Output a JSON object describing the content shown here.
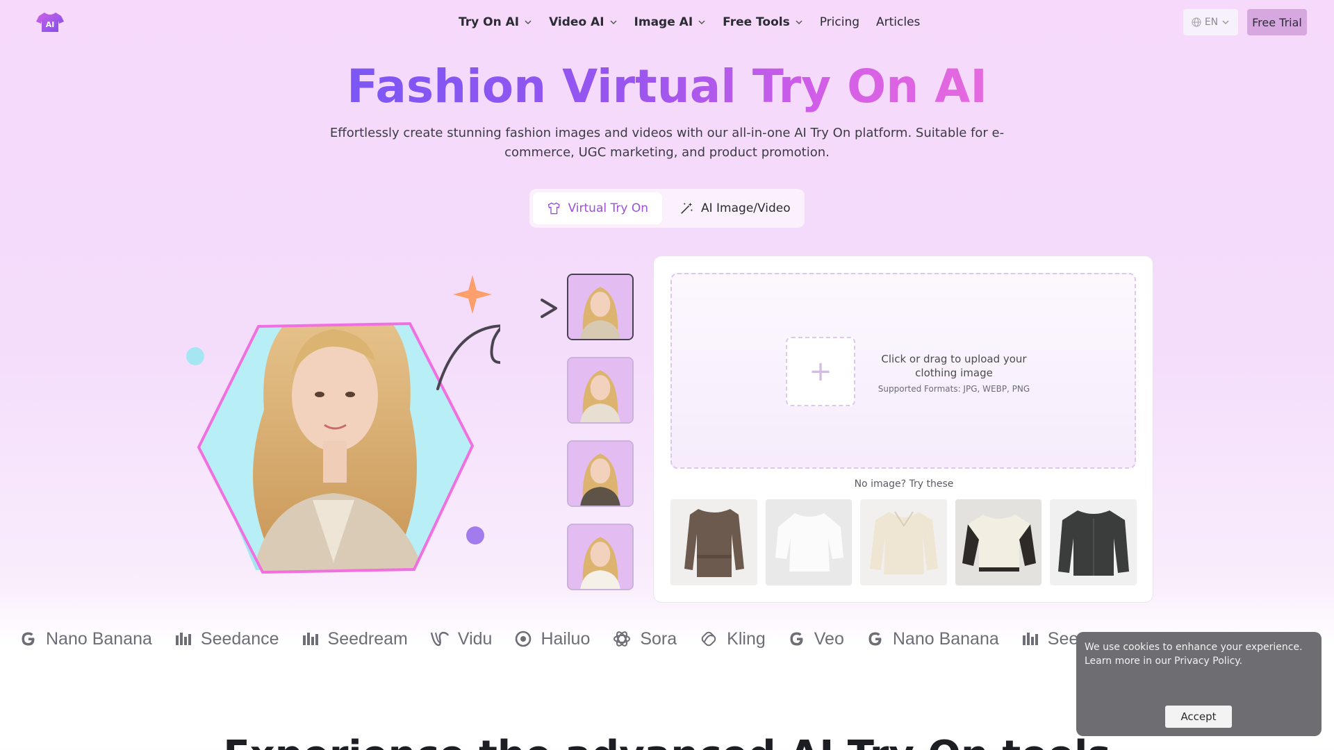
{
  "nav": {
    "logo_text": "AI",
    "links": [
      {
        "label": "Try On AI",
        "dropdown": true
      },
      {
        "label": "Video AI",
        "dropdown": true
      },
      {
        "label": "Image AI",
        "dropdown": true
      },
      {
        "label": "Free Tools",
        "dropdown": true
      },
      {
        "label": "Pricing",
        "dropdown": false
      },
      {
        "label": "Articles",
        "dropdown": false
      }
    ],
    "language": "EN",
    "cta": "Free Trial"
  },
  "hero": {
    "title": "Fashion Virtual Try On AI",
    "subtitle": "Effortlessly create stunning fashion images and videos with our all-in-one AI Try On platform. Suitable for e-commerce, UGC marketing, and product promotion."
  },
  "tabs": [
    {
      "label": "Virtual Try On",
      "active": true,
      "icon": "tshirt-icon"
    },
    {
      "label": "AI Image/Video",
      "active": false,
      "icon": "magic-wand-icon"
    }
  ],
  "upload": {
    "prompt": "Click or drag to upload your clothing image",
    "formats": "Supported Formats: JPG, WEBP, PNG",
    "try_these": "No image? Try these",
    "samples": [
      "brown-shirt-jacket",
      "white-blouse",
      "cream-sweater",
      "varsity-jacket",
      "black-leather-jacket"
    ]
  },
  "models": [
    {
      "name": "Nano Banana",
      "icon": "google-icon"
    },
    {
      "name": "Seedance",
      "icon": "bars-icon"
    },
    {
      "name": "Seedream",
      "icon": "bars-icon"
    },
    {
      "name": "Vidu",
      "icon": "vidu-icon"
    },
    {
      "name": "Hailuo",
      "icon": "hailuo-icon"
    },
    {
      "name": "Sora",
      "icon": "openai-icon"
    },
    {
      "name": "Kling",
      "icon": "kling-icon"
    },
    {
      "name": "Veo",
      "icon": "google-icon"
    },
    {
      "name": "Nano Banana",
      "icon": "google-icon"
    },
    {
      "name": "Seedance",
      "icon": "bars-icon"
    }
  ],
  "section_title": "Experience the advanced AI Try On tools",
  "cookie": {
    "text": "We use cookies to enhance your experience. Learn more in our Privacy Policy.",
    "accept": "Accept"
  },
  "colors": {
    "accent_purple": "#9c4fd6",
    "title_gradient_start": "#7c57f4",
    "title_gradient_end": "#e66adf",
    "cta_bg": "#d7a7df"
  }
}
